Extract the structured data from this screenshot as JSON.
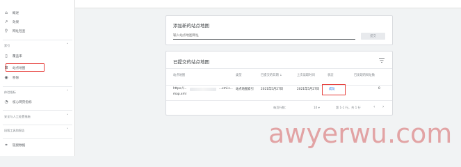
{
  "sidebar": {
    "items": [
      {
        "icon": "home-icon",
        "label": "概述"
      },
      {
        "icon": "trend-icon",
        "label": "效果"
      },
      {
        "icon": "search-icon",
        "label": "网址检查"
      }
    ],
    "section_index": {
      "label": "索引"
    },
    "index_items": [
      {
        "icon": "page-icon",
        "label": "覆盖率"
      },
      {
        "icon": "sitemap-icon",
        "label": "站点地图"
      },
      {
        "icon": "removal-icon",
        "label": "移除"
      }
    ],
    "section_experience": {
      "label": "体验指标"
    },
    "experience_items": [
      {
        "icon": "gauge-icon",
        "label": "核心网页指标"
      }
    ],
    "section_security": {
      "label": "安全与人工处置措施"
    },
    "section_legacy": {
      "label": "旧版工具和报告"
    },
    "bottom_items": [
      {
        "icon": "links-icon",
        "label": "链接数据"
      }
    ]
  },
  "add_card": {
    "title": "添加新的站点地图",
    "placeholder": "输入站点地图网址",
    "submit_label": "提交"
  },
  "submitted_card": {
    "title": "已提交的站点地图",
    "headers": [
      "站点地图",
      "类型",
      "已提交的日期",
      "上次读取时间",
      "状态",
      "已发现的网址数"
    ],
    "sort_arrow": "↓",
    "row": {
      "sitemap": "https://...",
      "sitemap_line2": "map.xml",
      "sitemap_tail": "...xml.s...",
      "type": "站点地图索引",
      "submitted": "2021年5月27日",
      "last_read": "2021年5月27日",
      "status": "成功",
      "discovered": "0"
    },
    "pagination": {
      "rows_label": "每页行数：",
      "rows_value": "10",
      "range": "第 1-1 行，共 1 行",
      "prev": "‹",
      "next": "›"
    }
  },
  "watermark": "awyerwu.com"
}
